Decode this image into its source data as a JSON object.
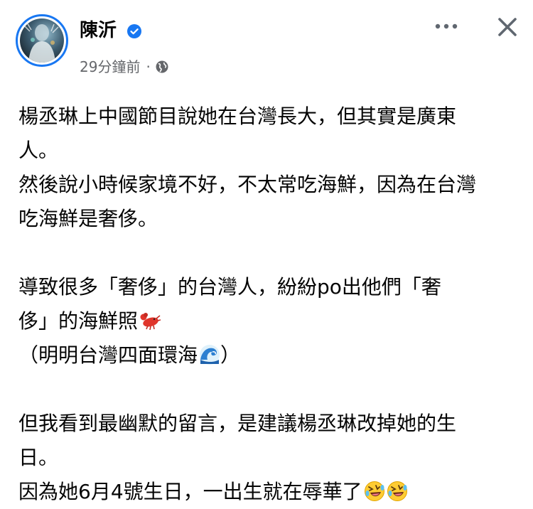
{
  "post": {
    "author": "陳沂",
    "time": "29分鐘前",
    "separator": "·",
    "privacy_icon": "globe-icon",
    "verified_color": "#1877f2"
  },
  "body": {
    "p1_line1": "楊丞琳上中國節目說她在台灣長大，但其實是廣東",
    "p1_line2": "人。",
    "p1_line3": "然後說小時候家境不好，不太常吃海鮮，因為在台灣",
    "p1_line4": "吃海鮮是奢侈。",
    "p2_line1": "導致很多「奢侈」的台灣人，紛紛po出他們「奢",
    "p2_line2": "侈」的海鮮照",
    "p2_line3_open": "（明明台灣四面環海",
    "p2_line3_close": "）",
    "p3_line1": "但我看到最幽默的留言，是建議楊丞琳改掉她的生",
    "p3_line2": "日。",
    "p3_line3": "因為她6月4號生日，一出生就在辱華了"
  },
  "emojis": {
    "lobster": "lobster-emoji",
    "wave": "wave-emoji",
    "laugh": "rolling-laughing-emoji"
  }
}
